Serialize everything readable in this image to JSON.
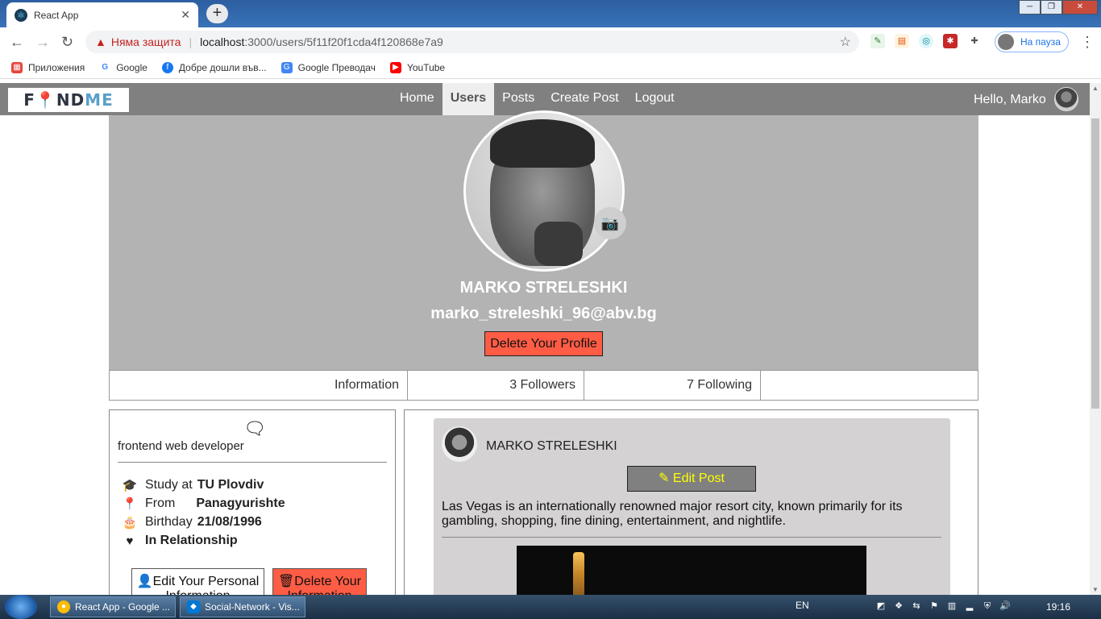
{
  "browser": {
    "tab_title": "React App",
    "tab_close": "✕",
    "new_tab": "+",
    "window_buttons": [
      "─",
      "❐",
      "✕"
    ],
    "security_label": "Няма защита",
    "url_host": "localhost",
    "url_path": ":3000/users/5f11f20f1cda4f120868e7a9",
    "profile_status": "На пауза",
    "bookmarks": [
      {
        "label": "Приложения",
        "icon": "apps-grid-icon",
        "color": "#e8453c"
      },
      {
        "label": "Google",
        "icon": "google-icon",
        "color": "#4285f4"
      },
      {
        "label": "Добре дошли във...",
        "icon": "facebook-icon",
        "color": "#1877f2"
      },
      {
        "label": "Google Преводач",
        "icon": "google-translate-icon",
        "color": "#4285f4"
      },
      {
        "label": "YouTube",
        "icon": "youtube-icon",
        "color": "#ff0000"
      }
    ]
  },
  "navbar": {
    "logo_text_a": "F",
    "logo_text_b": "ND",
    "logo_text_c": "ME",
    "links": [
      "Home",
      "Users",
      "Posts",
      "Create Post",
      "Logout"
    ],
    "active_link": "Users",
    "greeting": "Hello, Marko"
  },
  "profile": {
    "name": "MARKO STRELESHKI",
    "email": "marko_streleshki_96@abv.bg",
    "delete_button": "Delete Your Profile",
    "tabs": [
      "Information",
      "3 Followers",
      "7 Following",
      ""
    ]
  },
  "info": {
    "bio": "frontend web developer",
    "rows": [
      {
        "icon": "graduation-cap-icon",
        "glyph": "🎓",
        "label": "Study at",
        "value": "TU Plovdiv"
      },
      {
        "icon": "map-pin-icon",
        "glyph": "📍",
        "label": "From",
        "value": "Panagyurishte"
      },
      {
        "icon": "birthday-cake-icon",
        "glyph": "🎂",
        "label": "Birthday",
        "value": "21/08/1996"
      },
      {
        "icon": "heart-icon",
        "glyph": "♥",
        "label": "",
        "value": "In Relationship"
      }
    ],
    "edit_button": "Edit Your Personal Information",
    "delete_button": "Delete Your Information"
  },
  "post": {
    "author": "MARKO STRELESHKI",
    "edit_button": "Edit Post",
    "text": "Las Vegas is an internationally renowned major resort city, known primarily for its gambling, shopping, fine dining, entertainment, and nightlife."
  },
  "taskbar": {
    "items": [
      "React App - Google ...",
      "Social-Network - Vis..."
    ],
    "language": "EN",
    "time": "19:16"
  },
  "colors": {
    "navbar_bg": "#808080",
    "cover_bg": "#b3b3b3",
    "danger": "#ff5c45",
    "post_bg": "#d4d2d2",
    "edit_post_text": "#ffff00"
  }
}
